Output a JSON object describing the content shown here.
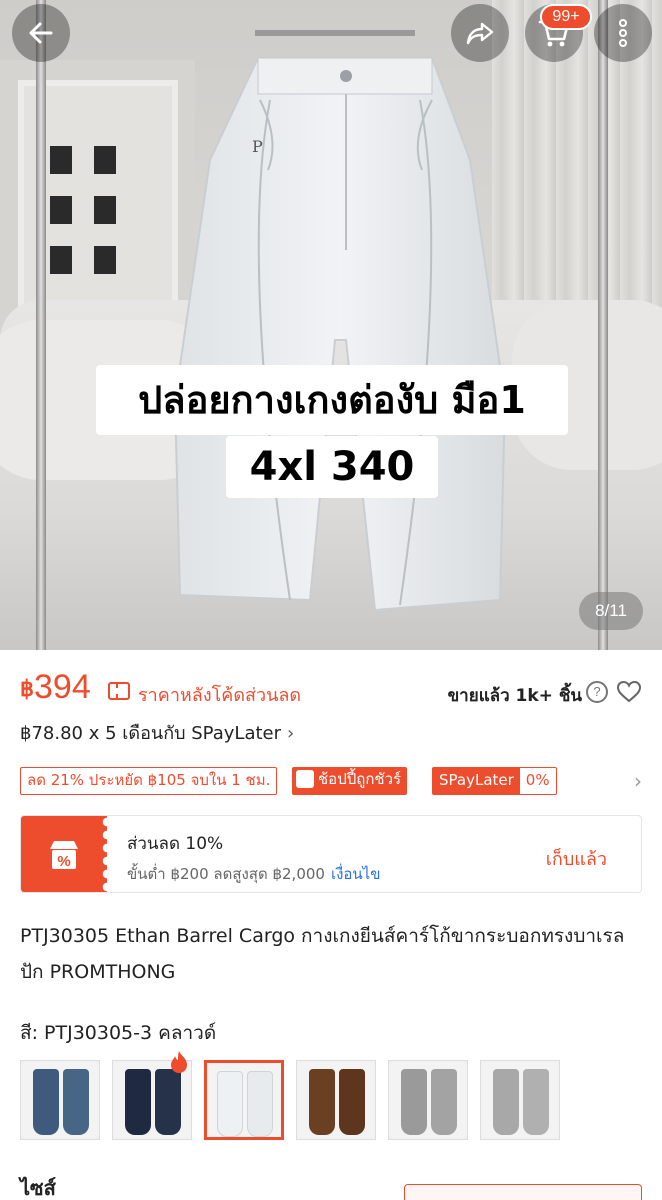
{
  "header": {
    "back_icon": "arrow-left-icon",
    "share_icon": "share-arrow-icon",
    "cart_icon": "shopping-cart-icon",
    "cart_badge": "99+",
    "more_icon": "vertical-dots-icon"
  },
  "gallery": {
    "overlay_line1": "ปล่อยกางเกงต่องับ มือ1",
    "overlay_line2": "4xl  340",
    "page_indicator": "8/11"
  },
  "price": {
    "currency": "฿",
    "value": "394",
    "note": "ราคาหลังโค้ดส่วนลด",
    "sold": "ขายแล้ว 1k+ ชิ้น",
    "help_icon": "question-circle-icon",
    "favorite_icon": "heart-outline-icon"
  },
  "installment": {
    "text": "฿78.80 x 5 เดือนกับ SPayLater",
    "chevron": "›"
  },
  "promos": {
    "discount_tag": "ลด 21% ประหยัด ฿105 จบใน 1 ชม.",
    "coupon_tag": "ช้อปปี้ถูกชัวร์",
    "spaylater_label": "SPayLater",
    "spaylater_rate": "0%",
    "chevron": "›"
  },
  "voucher": {
    "icon": "shop-percent-icon",
    "title": "ส่วนลด 10%",
    "subtitle": "ขั้นต่ำ ฿200 ลดสูงสุด ฿2,000",
    "condition_link": "เงื่อนไข",
    "action": "เก็บแล้ว"
  },
  "product": {
    "title": "PTJ30305 Ethan Barrel Cargo กางเกงยีนส์คาร์โก้ขากระบอกทรงบาเรลปัก PROMTHONG"
  },
  "variants": {
    "color_label": "สี: PTJ30305-3 คลาวด์",
    "swatches": [
      {
        "name": "dark-blue",
        "color": "#3e5a7c"
      },
      {
        "name": "navy",
        "color": "#1f2a40"
      },
      {
        "name": "cloud",
        "color": "#e8ebee",
        "selected": true
      },
      {
        "name": "brown",
        "color": "#6b3f22"
      },
      {
        "name": "grey",
        "color": "#9a9a9a"
      },
      {
        "name": "light-grey",
        "color": "#a8a8a8"
      }
    ],
    "hot_icon": "fire-icon",
    "size_label": "ไซส์"
  },
  "colors": {
    "accent": "#ee4d2d",
    "link": "#2673dd"
  }
}
